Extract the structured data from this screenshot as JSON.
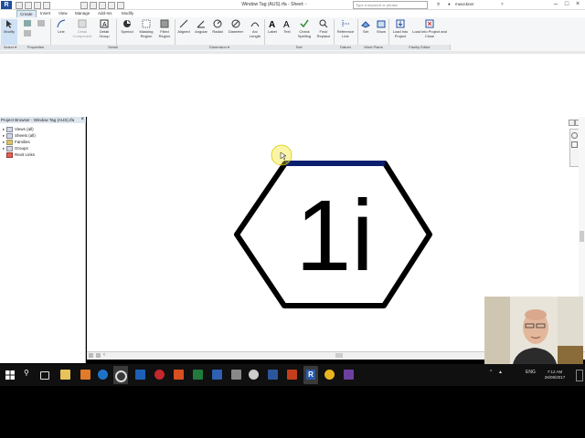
{
  "titlebar": {
    "title": "Window Tag (AUS).rfa - Sheet: -",
    "search_placeholder": "Type a keyword or phrase",
    "user": "mwockner"
  },
  "tabs": [
    "Create",
    "Insert",
    "View",
    "Manage",
    "Add-Ins",
    "Modify"
  ],
  "ribbon": {
    "buttons": [
      {
        "label": "Modify"
      },
      {
        "label": "Line"
      },
      {
        "label": "Detail Component"
      },
      {
        "label": "Detail Group"
      },
      {
        "label": "Symbol"
      },
      {
        "label": "Masking Region"
      },
      {
        "label": "Filled Region"
      },
      {
        "label": "Aligned"
      },
      {
        "label": "Angular"
      },
      {
        "label": "Radial"
      },
      {
        "label": "Diameter"
      },
      {
        "label": "Arc Length"
      },
      {
        "label": "Label"
      },
      {
        "label": "Text"
      },
      {
        "label": "Check Spelling"
      },
      {
        "label": "Find/ Replace"
      },
      {
        "label": "Reference Line"
      },
      {
        "label": "Set"
      },
      {
        "label": "Show"
      },
      {
        "label": "Load into Project"
      },
      {
        "label": "Load into Project and Close"
      }
    ],
    "panels": [
      "Select ▾",
      "Properties",
      "Detail",
      "Dimension ▾",
      "Text",
      "Datum",
      "Work Plane",
      "Family Editor"
    ]
  },
  "browser": {
    "title": "Project Browser - Window Tag (AUS).rfa",
    "items": [
      "Views (all)",
      "Sheets (all)",
      "Families",
      "Groups",
      "Revit Links"
    ]
  },
  "tag": {
    "text": "1i"
  },
  "taskbar": {
    "time": "7:12 AM",
    "date": "26/08/2017",
    "lang": "ENG"
  },
  "colors": {
    "accent": "#1f4e9c",
    "highlight_line": "#0a1f6e",
    "cursor": "#f2e300"
  }
}
